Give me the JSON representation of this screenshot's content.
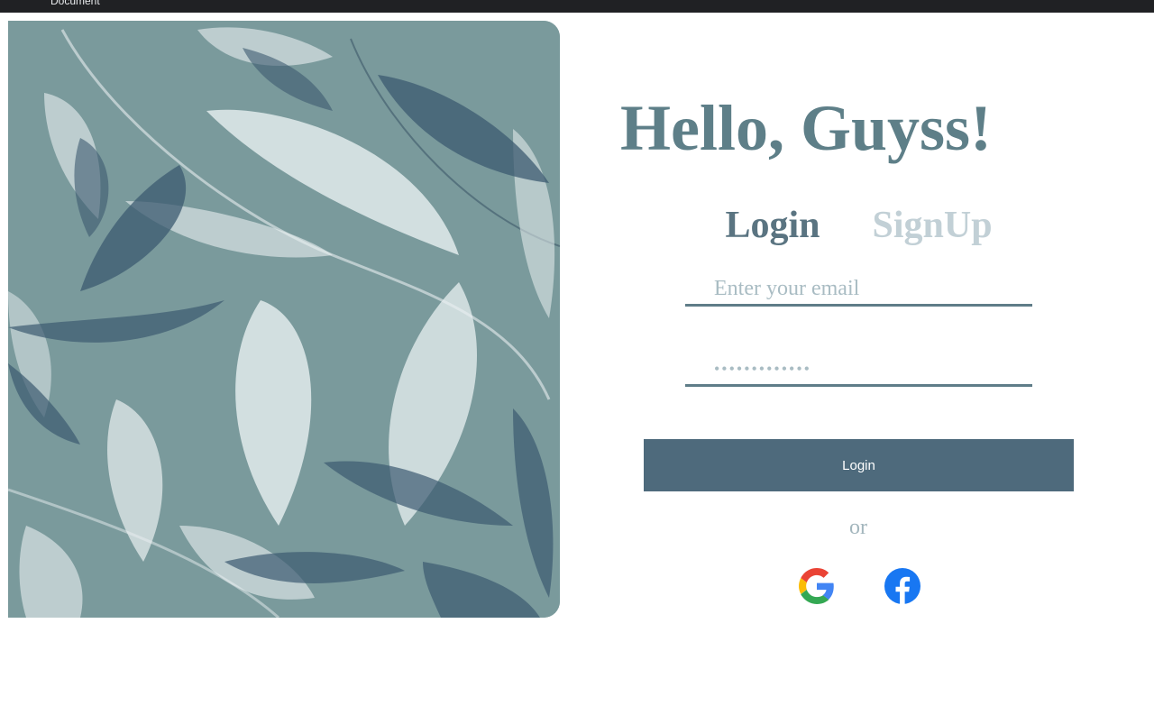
{
  "browser": {
    "tab_title": "Document"
  },
  "hero": {
    "title": "Hello, Guyss!"
  },
  "auth_tabs": {
    "login_label": "Login",
    "signup_label": "SignUp"
  },
  "form": {
    "email_placeholder": "Enter your email",
    "password_placeholder": "•••••••••••••",
    "submit_label": "Login"
  },
  "divider": {
    "or_text": "or"
  },
  "social": {
    "icons": [
      "google-icon",
      "facebook-icon"
    ]
  },
  "colors": {
    "title": "#5e7f88",
    "button": "#4e6a7c",
    "tab_active": "#5a7481",
    "tab_inactive": "#c2d0d6",
    "art_background": "#7a9a9c"
  }
}
